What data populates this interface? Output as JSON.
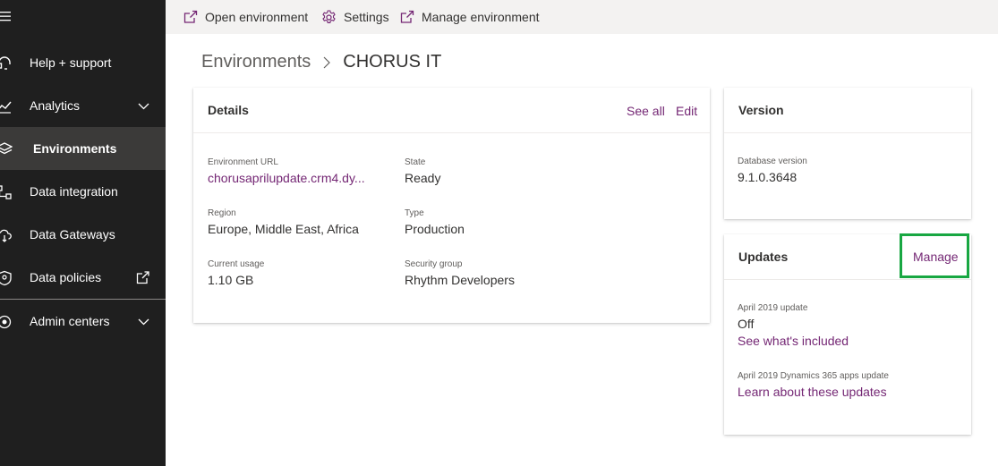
{
  "sidebar": {
    "items": [
      {
        "label": "Help + support",
        "icon": "headset-icon"
      },
      {
        "label": "Analytics",
        "icon": "analytics-icon"
      },
      {
        "label": "Environments",
        "icon": "layers-icon",
        "active": true
      },
      {
        "label": "Data integration",
        "icon": "data-integration-icon"
      },
      {
        "label": "Data Gateways",
        "icon": "cloud-gateway-icon"
      },
      {
        "label": "Data policies",
        "icon": "shield-icon"
      },
      {
        "label": "Admin centers",
        "icon": "admin-centers-icon"
      }
    ]
  },
  "commandbar": {
    "open_environment": "Open environment",
    "settings": "Settings",
    "manage_environment": "Manage environment"
  },
  "breadcrumb": {
    "root": "Environments",
    "current": "CHORUS IT"
  },
  "details": {
    "title": "Details",
    "see_all": "See all",
    "edit": "Edit",
    "environment_url_label": "Environment URL",
    "environment_url": "chorusaprilupdate.crm4.dy...",
    "state_label": "State",
    "state": "Ready",
    "region_label": "Region",
    "region": "Europe, Middle East, Africa",
    "type_label": "Type",
    "type": "Production",
    "usage_label": "Current usage",
    "usage": "1.10 GB",
    "security_group_label": "Security group",
    "security_group": "Rhythm Developers"
  },
  "version": {
    "title": "Version",
    "db_label": "Database version",
    "db_value": "9.1.0.3648"
  },
  "updates": {
    "title": "Updates",
    "manage": "Manage",
    "april_label": "April 2019 update",
    "april_value": "Off",
    "april_link": "See what's included",
    "d365_label": "April 2019 Dynamics 365 apps update",
    "d365_link": "Learn about these updates"
  },
  "colors": {
    "sidebar_bg": "#1f1f1f",
    "sidebar_active": "#3b3a39",
    "link": "#742774",
    "highlight": "#18a742"
  }
}
